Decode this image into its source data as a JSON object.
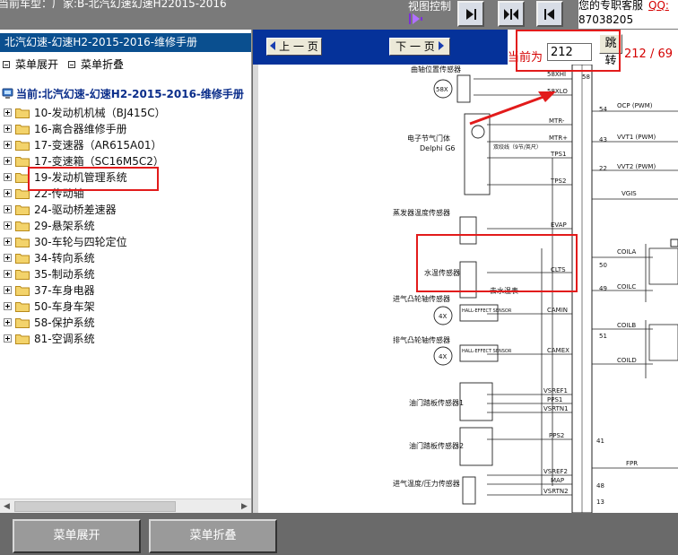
{
  "topbar": {
    "car_model": "当前车型：厂家:B-北汽幻速幻速H22015-2016",
    "view_control": "视图控制",
    "service_text": "您的专职客服",
    "qq_label": "QQ:",
    "phone": "87038205"
  },
  "left": {
    "header": "北汽幻速-幻速H2-2015-2016-维修手册",
    "expand_label": "菜单展开",
    "collapse_label": "菜单折叠",
    "current_label": "当前:北汽幻速-幻速H2-2015-2016-维修手册",
    "tree": [
      {
        "label": "10-发动机机械（BJ415C）"
      },
      {
        "label": "16-离合器维修手册"
      },
      {
        "label": "17-变速器（AR615A01）"
      },
      {
        "label": "17-变速箱（SC16M5C2）"
      },
      {
        "label": "19-发动机管理系统"
      },
      {
        "label": "22-传动轴"
      },
      {
        "label": "24-驱动桥差速器"
      },
      {
        "label": "29-悬架系统"
      },
      {
        "label": "30-车轮与四轮定位"
      },
      {
        "label": "34-转向系统"
      },
      {
        "label": "35-制动系统"
      },
      {
        "label": "37-车身电器"
      },
      {
        "label": "50-车身车架"
      },
      {
        "label": "58-保护系统"
      },
      {
        "label": "81-空调系统"
      }
    ]
  },
  "toolbar": {
    "prev_label": "上 一 页",
    "next_label": "下 一 页",
    "current_page_label": "当前为",
    "page_value": "212",
    "jump_label": "跳转",
    "page_count": "212 / 69"
  },
  "diagram": {
    "sensors": [
      "曲轴位置传感器",
      "电子节气门体",
      "Delphi G6",
      "蒸发器温度传感器",
      "水温传感器",
      "进气凸轮轴传感器",
      "排气凸轮轴传感器",
      "油门踏板传感器1",
      "油门踏板传感器2",
      "进气温度/压力传感器"
    ],
    "signals": [
      "58XHI",
      "58XLO",
      "MTR-",
      "MTR+",
      "TPS1",
      "TPS2",
      "EVAP",
      "CLTS",
      "CAMIN",
      "CAMEX",
      "VSREF1",
      "PPS1",
      "VSRTN1",
      "PPS2",
      "VSREF2",
      "MAP",
      "VSRTN2"
    ],
    "pins": [
      "58",
      "54",
      "43",
      "22",
      "50",
      "49",
      "51",
      "41",
      "48",
      "13"
    ],
    "right_labels": [
      "OCP (PWM)",
      "VVT1 (PWM)",
      "VVT2 (PWM)",
      "VGIS",
      "COILA",
      "COILC",
      "COILB",
      "COILD",
      "FPR"
    ],
    "notes": [
      "58X",
      "4X",
      "4X",
      "HALL-EFFECT SENSOR",
      "HALL-EFFECT SENSOR",
      "去水温表",
      "双绞线（9节/英尺）"
    ]
  },
  "bottom": {
    "expand_label": "菜单展开",
    "collapse_label": "菜单折叠"
  },
  "colors": {
    "toolbar_blue": "#05329a",
    "header_blue": "#0a4f8f",
    "highlight_red": "#e21b1b",
    "page_red": "#d40000"
  }
}
